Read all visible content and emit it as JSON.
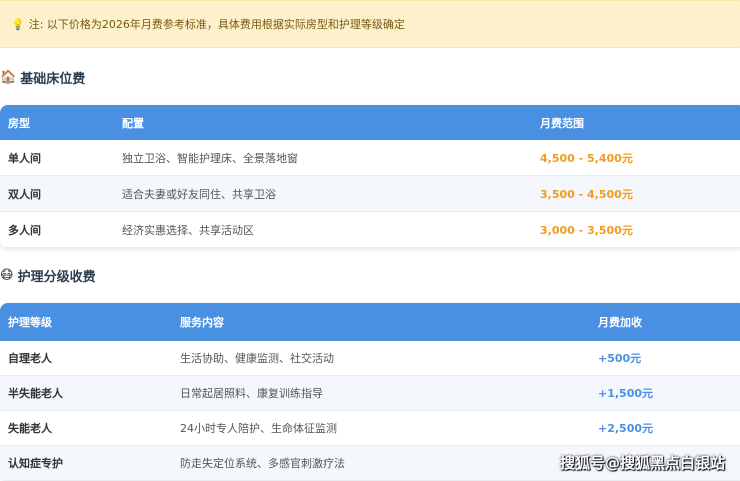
{
  "note": {
    "icon": "lightbulb-icon",
    "text": "注: 以下价格为2026年月费参考标准，具体费用根据实际房型和护理等级确定"
  },
  "bed": {
    "icon": "house-icon",
    "title": "基础床位费",
    "headers": [
      "房型",
      "配置",
      "月费范围"
    ],
    "rows": [
      [
        "单人间",
        "独立卫浴、智能护理床、全景落地窗",
        "4,500 - 5,400元"
      ],
      [
        "双人间",
        "适合夫妻或好友同住、共享卫浴",
        "3,500 - 4,500元"
      ],
      [
        "多人间",
        "经济实惠选择、共享活动区",
        "3,000 - 3,500元"
      ]
    ]
  },
  "care": {
    "icon": "elder-face-icon",
    "title": "护理分级收费",
    "headers": [
      "护理等级",
      "服务内容",
      "月费加收"
    ],
    "rows": [
      [
        "自理老人",
        "生活协助、健康监测、社交活动",
        "+500元"
      ],
      [
        "半失能老人",
        "日常起居照料、康复训练指导",
        "+1,500元"
      ],
      [
        "失能老人",
        "24小时专人陪护、生命体征监测",
        "+2,500元"
      ],
      [
        "认知症专护",
        "防走失定位系统、多感官刺激疗法",
        ""
      ]
    ]
  },
  "watermark": "搜狐号@搜狐黑点白银站",
  "colors": {
    "header": "#4a90e2",
    "price_orange": "#f29b1d",
    "price_blue": "#4a90e2"
  }
}
